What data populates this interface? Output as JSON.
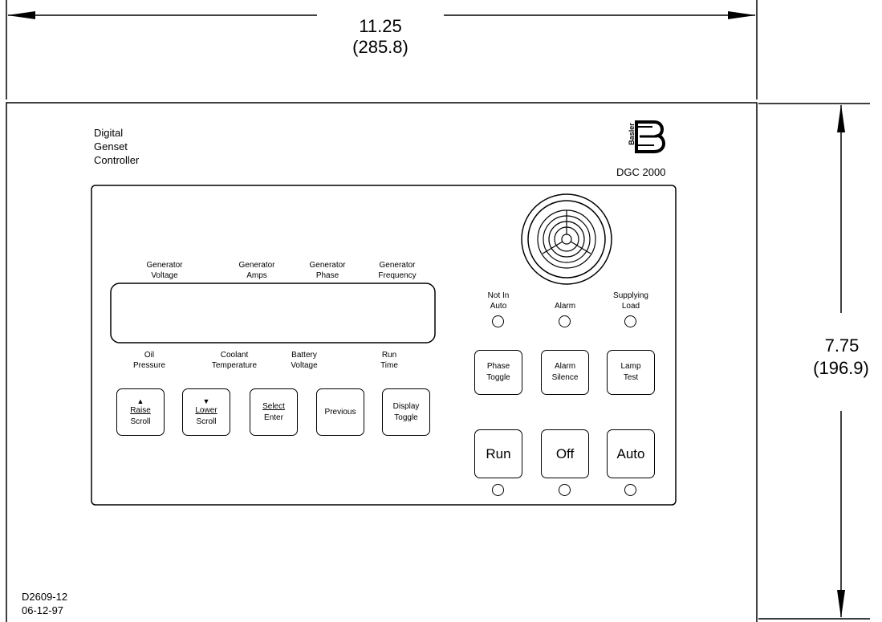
{
  "dimensions": {
    "width_in": "11.25",
    "width_mm": "(285.8)",
    "height_in": "7.75",
    "height_mm": "(196.9)"
  },
  "panel": {
    "product_name_lines": [
      "Digital",
      "Genset",
      "Controller"
    ],
    "brand": "Basler",
    "model": "DGC 2000"
  },
  "display_labels": {
    "top": [
      {
        "line1": "Generator",
        "line2": "Voltage"
      },
      {
        "line1": "Generator",
        "line2": "Amps"
      },
      {
        "line1": "Generator",
        "line2": "Phase"
      },
      {
        "line1": "Generator",
        "line2": "Frequency"
      }
    ],
    "bottom": [
      {
        "line1": "Oil",
        "line2": "Pressure"
      },
      {
        "line1": "Coolant",
        "line2": "Temperature"
      },
      {
        "line1": "Battery",
        "line2": "Voltage"
      },
      {
        "line1": "Run",
        "line2": "Time"
      }
    ]
  },
  "nav_buttons": [
    {
      "arrow": "▲",
      "line1": "Raise",
      "line2": "Scroll"
    },
    {
      "arrow": "▼",
      "line1": "Lower",
      "line2": "Scroll"
    },
    {
      "line1": "Select",
      "line2": "Enter"
    },
    {
      "line1": "Previous"
    },
    {
      "line1": "Display",
      "line2": "Toggle"
    }
  ],
  "indicators": [
    {
      "line1": "Not In",
      "line2": "Auto"
    },
    {
      "line1": "Alarm"
    },
    {
      "line1": "Supplying",
      "line2": "Load"
    }
  ],
  "function_buttons": [
    {
      "line1": "Phase",
      "line2": "Toggle"
    },
    {
      "line1": "Alarm",
      "line2": "Silence"
    },
    {
      "line1": "Lamp",
      "line2": "Test"
    }
  ],
  "mode_buttons": [
    "Run",
    "Off",
    "Auto"
  ],
  "drawing": {
    "number": "D2609-12",
    "date": "06-12-97"
  }
}
